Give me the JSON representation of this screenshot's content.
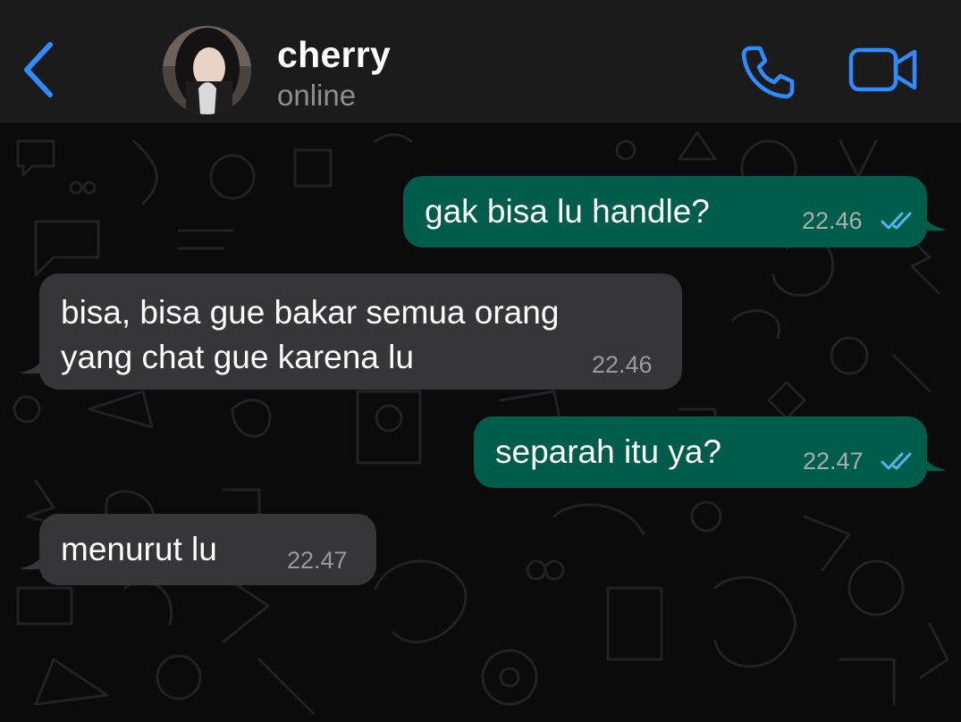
{
  "header": {
    "contact_name": "cherry",
    "status": "online"
  },
  "icons": {
    "back": "chevron-left-icon",
    "call": "phone-icon",
    "video": "video-camera-icon",
    "read_receipt": "double-check-icon"
  },
  "colors": {
    "accent": "#2f8cff",
    "outgoing_bubble": "#005c4b",
    "incoming_bubble": "#363638",
    "header_bg": "#1b1b1c",
    "read_tick": "#4fb6ec"
  },
  "messages": [
    {
      "direction": "outgoing",
      "text": "gak bisa lu handle?",
      "time": "22.46",
      "status": "read"
    },
    {
      "direction": "incoming",
      "text": "bisa, bisa gue bakar semua orang\nyang chat gue karena lu",
      "time": "22.46"
    },
    {
      "direction": "outgoing",
      "text": "separah itu ya?",
      "time": "22.47",
      "status": "read"
    },
    {
      "direction": "incoming",
      "text": "menurut lu",
      "time": "22.47"
    }
  ]
}
